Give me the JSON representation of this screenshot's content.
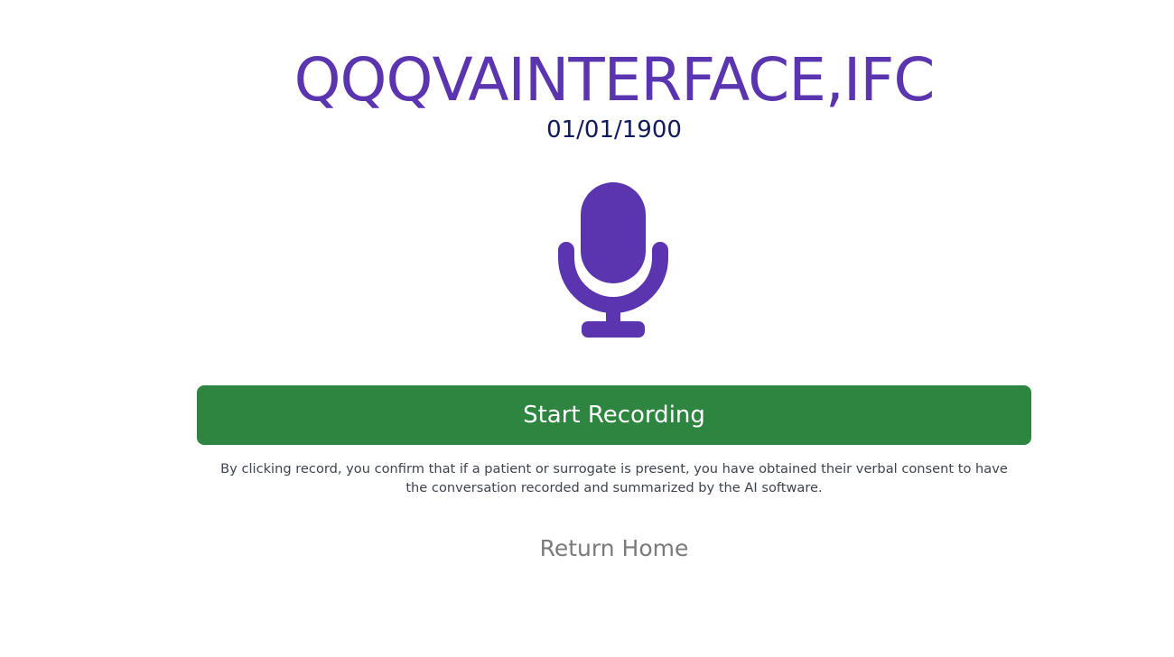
{
  "header": {
    "patient_name": "QQQVAINTERFACE,IFC",
    "date": "01/01/1900"
  },
  "icons": {
    "microphone": "microphone-icon"
  },
  "actions": {
    "record_label": "Start Recording",
    "consent_text": "By clicking record, you confirm that if a patient or surrogate is present, you have obtained their verbal consent to have the conversation recorded and summarized by the AI software.",
    "return_home_label": "Return Home"
  },
  "colors": {
    "accent": "#5b35b0",
    "date_text": "#101a5c",
    "record_button": "#2e8540",
    "consent_text": "#3e4350",
    "link_text": "#7a7a7a"
  }
}
